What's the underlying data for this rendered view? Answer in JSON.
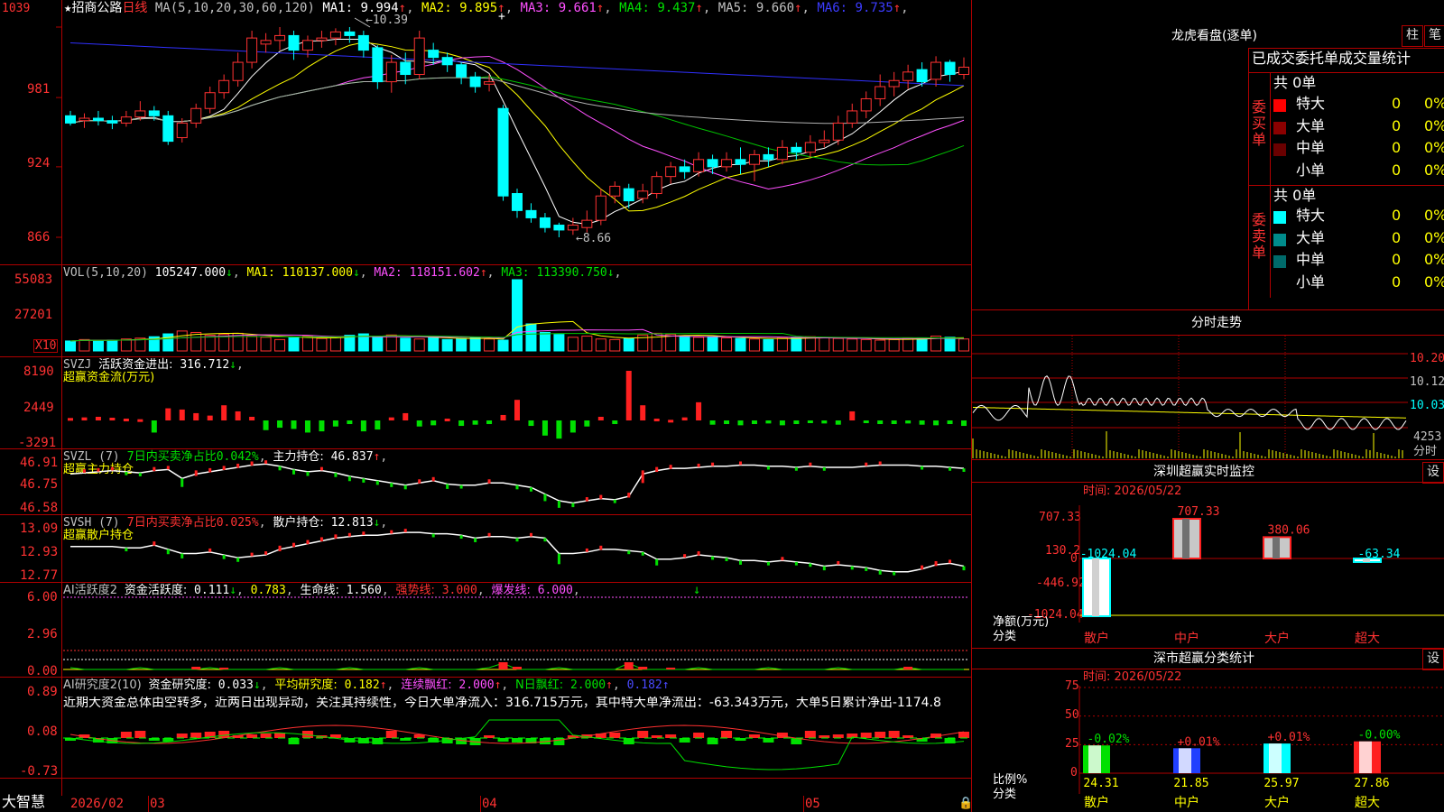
{
  "app": {
    "brand": "大智慧",
    "stock_name": "招商公路",
    "period": "日线",
    "star": "★"
  },
  "kline": {
    "ma_header": "MA(5,10,20,30,60,120)",
    "ma": [
      {
        "label": "MA1:",
        "value": "9.994",
        "arrow": "↑",
        "color": "#ffffff"
      },
      {
        "label": "MA2:",
        "value": "9.895",
        "arrow": "↑",
        "color": "#ffff00"
      },
      {
        "label": "MA3:",
        "value": "9.661",
        "arrow": "↑",
        "color": "#ff50ff"
      },
      {
        "label": "MA4:",
        "value": "9.437",
        "arrow": "↑",
        "color": "#00e000"
      },
      {
        "label": "MA5:",
        "value": "9.660",
        "arrow": "↑",
        "color": "#c0c0c0"
      },
      {
        "label": "MA6:",
        "value": "9.735",
        "arrow": "↑",
        "color": "#3c3cff"
      }
    ],
    "yticks": [
      "1039",
      "981",
      "924",
      "866"
    ],
    "high_label": "10.39",
    "low_label": "8.66",
    "candles": [
      [
        9.66,
        9.6,
        9.7,
        9.58
      ],
      [
        9.62,
        9.64,
        9.68,
        9.56
      ],
      [
        9.64,
        9.62,
        9.7,
        9.58
      ],
      [
        9.62,
        9.6,
        9.66,
        9.55
      ],
      [
        9.6,
        9.65,
        9.7,
        9.57
      ],
      [
        9.65,
        9.7,
        9.78,
        9.62
      ],
      [
        9.7,
        9.66,
        9.74,
        9.62
      ],
      [
        9.66,
        9.45,
        9.7,
        9.42
      ],
      [
        9.48,
        9.6,
        9.64,
        9.44
      ],
      [
        9.6,
        9.72,
        9.76,
        9.56
      ],
      [
        9.72,
        9.85,
        9.9,
        9.68
      ],
      [
        9.85,
        9.95,
        10.0,
        9.8
      ],
      [
        9.95,
        10.1,
        10.18,
        9.9
      ],
      [
        10.1,
        10.3,
        10.36,
        10.05
      ],
      [
        10.25,
        10.28,
        10.34,
        10.18
      ],
      [
        10.28,
        10.32,
        10.39,
        10.2
      ],
      [
        10.32,
        10.2,
        10.36,
        10.12
      ],
      [
        10.2,
        10.28,
        10.32,
        10.14
      ],
      [
        10.28,
        10.3,
        10.36,
        10.22
      ],
      [
        10.3,
        10.35,
        10.38,
        10.24
      ],
      [
        10.35,
        10.32,
        10.39,
        10.26
      ],
      [
        10.32,
        10.2,
        10.36,
        10.14
      ],
      [
        10.22,
        9.94,
        10.24,
        9.88
      ],
      [
        9.94,
        10.1,
        10.16,
        9.85
      ],
      [
        10.1,
        10.0,
        10.18,
        9.92
      ],
      [
        10.0,
        10.3,
        10.36,
        9.96
      ],
      [
        10.2,
        10.14,
        10.26,
        10.08
      ],
      [
        10.14,
        10.08,
        10.18,
        10.02
      ],
      [
        10.08,
        9.98,
        10.1,
        9.92
      ],
      [
        9.98,
        9.9,
        10.02,
        9.85
      ],
      [
        9.92,
        9.94,
        10.0,
        9.86
      ],
      [
        9.72,
        9.0,
        9.75,
        8.96
      ],
      [
        9.02,
        8.88,
        9.06,
        8.82
      ],
      [
        8.88,
        8.82,
        8.94,
        8.78
      ],
      [
        8.82,
        8.74,
        8.86,
        8.7
      ],
      [
        8.76,
        8.72,
        8.78,
        8.66
      ],
      [
        8.72,
        8.76,
        8.82,
        8.68
      ],
      [
        8.74,
        8.8,
        8.88,
        8.7
      ],
      [
        8.8,
        9.0,
        9.06,
        8.76
      ],
      [
        9.0,
        9.08,
        9.12,
        8.94
      ],
      [
        9.06,
        8.96,
        9.1,
        8.9
      ],
      [
        8.98,
        9.04,
        9.1,
        8.94
      ],
      [
        9.02,
        9.16,
        9.2,
        8.98
      ],
      [
        9.16,
        9.24,
        9.28,
        9.1
      ],
      [
        9.24,
        9.2,
        9.3,
        9.14
      ],
      [
        9.2,
        9.3,
        9.36,
        9.16
      ],
      [
        9.3,
        9.24,
        9.34,
        9.18
      ],
      [
        9.24,
        9.3,
        9.36,
        9.2
      ],
      [
        9.3,
        9.26,
        9.4,
        9.18
      ],
      [
        9.26,
        9.34,
        9.38,
        9.12
      ],
      [
        9.34,
        9.3,
        9.4,
        9.24
      ],
      [
        9.3,
        9.4,
        9.46,
        9.26
      ],
      [
        9.4,
        9.36,
        9.44,
        9.3
      ],
      [
        9.36,
        9.44,
        9.5,
        9.32
      ],
      [
        9.44,
        9.46,
        9.54,
        9.4
      ],
      [
        9.46,
        9.6,
        9.66,
        9.42
      ],
      [
        9.6,
        9.7,
        9.76,
        9.56
      ],
      [
        9.7,
        9.8,
        9.86,
        9.64
      ],
      [
        9.8,
        9.9,
        10.0,
        9.74
      ],
      [
        9.9,
        9.95,
        10.02,
        9.82
      ],
      [
        9.95,
        10.02,
        10.08,
        9.88
      ],
      [
        10.04,
        9.94,
        10.1,
        9.9
      ],
      [
        9.96,
        10.1,
        10.15,
        9.9
      ],
      [
        10.1,
        10.0,
        10.12,
        9.94
      ],
      [
        10.0,
        10.06,
        10.14,
        9.96
      ]
    ]
  },
  "volume": {
    "header": "VOL(5,10,20)",
    "value": "105247.000",
    "value_arrow": "↓",
    "ma": [
      {
        "label": "MA1:",
        "value": "110137.000",
        "arrow": "↓",
        "color": "#ffff00"
      },
      {
        "label": "MA2:",
        "value": "118151.602",
        "arrow": "↑",
        "color": "#ff50ff"
      },
      {
        "label": "MA3:",
        "value": "113390.750",
        "arrow": "↓",
        "color": "#00e000"
      }
    ],
    "yticks": [
      "55083",
      "27201"
    ],
    "unit": "X10",
    "bars": [
      35,
      40,
      36,
      38,
      42,
      45,
      50,
      60,
      70,
      65,
      55,
      58,
      62,
      52,
      48,
      40,
      46,
      52,
      44,
      48,
      55,
      60,
      50,
      56,
      45,
      42,
      48,
      40,
      44,
      46,
      42,
      38,
      250,
      95,
      65,
      58,
      48,
      52,
      42,
      40,
      44,
      56,
      62,
      58,
      52,
      48,
      50,
      46,
      44,
      42,
      40,
      45,
      48,
      50,
      46,
      44,
      42,
      40,
      38,
      40,
      44,
      46,
      52,
      48,
      42
    ]
  },
  "svzj": {
    "name": "SVZJ",
    "label": "活跃资金进出:",
    "value": "316.712",
    "arrow": "↓",
    "subtitle": "超赢资金流(万元)",
    "yticks": [
      "8190",
      "2449",
      "-3291"
    ],
    "values": [
      400,
      500,
      600,
      450,
      300,
      200,
      -2000,
      2000,
      1800,
      1200,
      800,
      2500,
      1500,
      600,
      -1600,
      -1200,
      -1400,
      -2000,
      -1800,
      -1000,
      -600,
      -1800,
      -1500,
      500,
      1200,
      -1000,
      -800,
      300,
      -900,
      -700,
      -600,
      900,
      3400,
      -900,
      -2500,
      -3000,
      -2000,
      -1000,
      600,
      -600,
      8190,
      2500,
      300,
      100,
      500,
      3000,
      -700,
      -600,
      -800,
      -600,
      -500,
      -800,
      -600,
      -400,
      -500,
      -700,
      1500,
      -400,
      -600,
      -600,
      -500,
      -700,
      -800,
      -600,
      -900,
      -700,
      2000,
      -500
    ]
  },
  "svzl": {
    "name": "SVZL",
    "params": "(7)",
    "ratio_label": "7日内买卖净占比",
    "ratio_value": "0.042%",
    "label": "主力持仓:",
    "value": "46.837",
    "arrow": "↑",
    "subtitle": "超赢主力持仓",
    "yticks": [
      "46.91",
      "46.75",
      "46.58"
    ],
    "values": [
      46.84,
      46.85,
      46.86,
      46.87,
      46.86,
      46.85,
      46.87,
      46.88,
      46.8,
      46.84,
      46.86,
      46.88,
      46.9,
      46.92,
      46.93,
      46.91,
      46.88,
      46.86,
      46.87,
      46.85,
      46.82,
      46.8,
      46.78,
      46.76,
      46.74,
      46.76,
      46.78,
      46.75,
      46.74,
      46.74,
      46.76,
      46.76,
      46.74,
      46.72,
      46.66,
      46.6,
      46.58,
      46.6,
      46.62,
      46.61,
      46.64,
      46.84,
      46.87,
      46.89,
      46.89,
      46.9,
      46.91,
      46.91,
      46.92,
      46.92,
      46.91,
      46.91,
      46.9,
      46.91,
      46.9,
      46.9,
      46.9,
      46.91,
      46.92,
      46.92,
      46.92,
      46.91,
      46.91,
      46.9,
      46.89,
      46.86,
      46.84,
      46.86,
      46.86
    ]
  },
  "svsh": {
    "name": "SVSH",
    "params": "(7)",
    "ratio_label": "7日内买卖净占比",
    "ratio_value": "0.025%",
    "label": "散户持仓:",
    "value": "12.813",
    "arrow": "↓",
    "subtitle": "超赢散户持仓",
    "yticks": [
      "13.09",
      "12.93",
      "12.77"
    ],
    "values": [
      12.98,
      12.98,
      12.98,
      12.98,
      12.97,
      12.97,
      12.99,
      12.96,
      12.93,
      12.93,
      12.94,
      12.92,
      12.9,
      12.91,
      12.92,
      12.96,
      12.98,
      13.0,
      13.02,
      13.04,
      13.05,
      13.06,
      13.06,
      13.07,
      13.08,
      13.08,
      13.07,
      13.07,
      13.06,
      13.04,
      13.05,
      13.05,
      13.04,
      13.05,
      13.04,
      12.93,
      12.93,
      12.94,
      12.96,
      12.96,
      12.95,
      12.94,
      12.89,
      12.89,
      12.9,
      12.92,
      12.91,
      12.9,
      12.88,
      12.88,
      12.87,
      12.88,
      12.87,
      12.86,
      12.84,
      12.85,
      12.84,
      12.83,
      12.81,
      12.8,
      12.8,
      12.82,
      12.85,
      12.86,
      12.84,
      12.82,
      12.8
    ]
  },
  "ai_activity": {
    "name": "AI活跃度2",
    "label": "资金活跃度:",
    "v1": "0.111",
    "v1_arrow": "↓",
    "v2": "0.783",
    "life_label": "生命线:",
    "life_value": "1.560",
    "strong_label": "强势线:",
    "strong_value": "3.000",
    "burst_label": "爆发线:",
    "burst_value": "6.000",
    "marker": "↓",
    "yticks": [
      "6.00",
      "2.96",
      "0.00"
    ]
  },
  "ai_research": {
    "name": "AI研究度2(10)",
    "label": "资金研究度:",
    "value": "0.033",
    "arrow": "↓",
    "avg_label": "平均研究度:",
    "avg_value": "0.182",
    "avg_arrow": "↑",
    "cont_label": "连续飘红:",
    "cont_value": "2.000",
    "cont_arrow": "↑",
    "nday_label": "N日飘红:",
    "nday_value": "2.000",
    "nday_arrow": "↑",
    "last_value": "0.182",
    "last_arrow": "↑",
    "commentary": "近期大资金总体由空转多，近两日出现异动，关注其持续性，今日大单净流入：316.715万元，其中特大单净流出：-63.343万元，大单5日累计净出-1174.8",
    "yticks": [
      "0.89",
      "0.08",
      "-0.73"
    ]
  },
  "dates": {
    "d1": "2026/02",
    "d2": "03",
    "d3": "04",
    "d4": "05"
  },
  "dragon": {
    "title": "龙虎看盘(逐单)",
    "btn_bar": "柱",
    "btn_pen": "笔",
    "subtitle": "已成交委托单成交量统计",
    "buy_label": "委买单",
    "sell_label": "委卖单",
    "buy_total": "共 0单",
    "sell_total": "共 0单",
    "buy_rows": [
      {
        "label": "特大",
        "count": "0",
        "pct": "0%",
        "color": "#ff0000"
      },
      {
        "label": "大单",
        "count": "0",
        "pct": "0%",
        "color": "#8b0000"
      },
      {
        "label": "中单",
        "count": "0",
        "pct": "0%",
        "color": "#6a0000"
      },
      {
        "label": "小单",
        "count": "0",
        "pct": "0%",
        "color": ""
      }
    ],
    "sell_rows": [
      {
        "label": "特大",
        "count": "0",
        "pct": "0%",
        "color": "#00ffff"
      },
      {
        "label": "大单",
        "count": "0",
        "pct": "0%",
        "color": "#008b8b"
      },
      {
        "label": "中单",
        "count": "0",
        "pct": "0%",
        "color": "#006a6a"
      },
      {
        "label": "小单",
        "count": "0",
        "pct": "0%",
        "color": ""
      }
    ]
  },
  "intraday": {
    "title": "分时走势",
    "yticks": [
      "10.20",
      "10.12",
      "10.03"
    ],
    "vol_label": "4253",
    "time_label": "分时"
  },
  "sz_monitor": {
    "title": "深圳超赢实时监控",
    "btn": "设",
    "time": "时间: 2026/05/22",
    "yticks": [
      "707.33",
      "130.2",
      "0",
      "-446.92",
      "-1024.04"
    ],
    "unit_label": "净额(万元)",
    "class_label": "分类",
    "bars": [
      {
        "cat": "散户",
        "value": -1024.04,
        "label": "-1024.04"
      },
      {
        "cat": "中户",
        "value": 707.33,
        "label": "707.33"
      },
      {
        "cat": "大户",
        "value": 380.06,
        "label": "380.06"
      },
      {
        "cat": "超大",
        "value": -63.34,
        "label": "-63.34"
      }
    ]
  },
  "sz_class": {
    "title": "深市超赢分类统计",
    "btn": "设",
    "time": "时间: 2026/05/22",
    "yticks": [
      "75",
      "50",
      "25",
      "0"
    ],
    "ratio_label": "比例%",
    "class_label": "分类",
    "bars": [
      {
        "cat": "散户",
        "value": 24.31,
        "change": "-0.02%",
        "color": "#00e000"
      },
      {
        "cat": "中户",
        "value": 21.85,
        "change": "+0.01%",
        "color": "#2040ff"
      },
      {
        "cat": "大户",
        "value": 25.97,
        "change": "+0.01%",
        "color": "#00ffff"
      },
      {
        "cat": "超大",
        "value": 27.86,
        "change": "-0.00%",
        "color": "#ff2020"
      }
    ]
  },
  "colors": {
    "up": "#ff3232",
    "down": "#00ffff",
    "grid": "#b00000",
    "bg": "#000000"
  }
}
